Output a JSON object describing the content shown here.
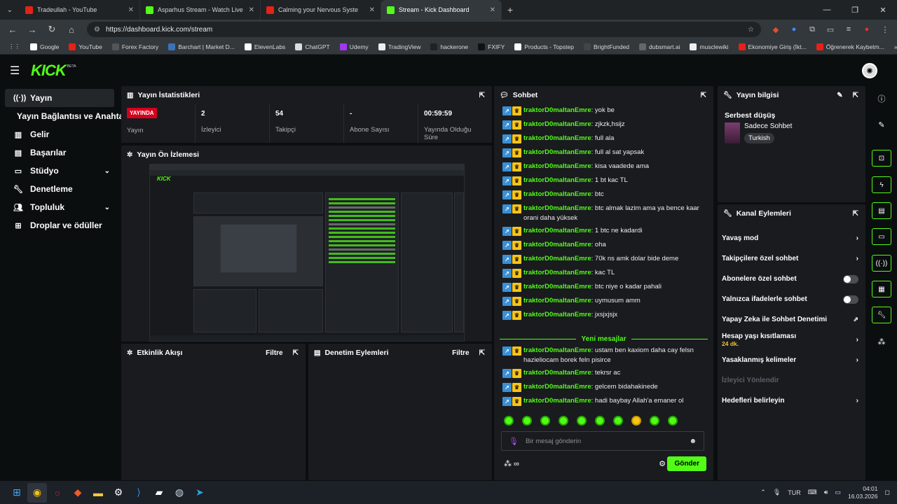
{
  "browser": {
    "tabs": [
      {
        "title": "Tradeullah - YouTube",
        "fav": "yt"
      },
      {
        "title": "Asparhus Stream - Watch Live o",
        "fav": "kick"
      },
      {
        "title": "Calming your Nervous Syste",
        "fav": "yt"
      },
      {
        "title": "Stream - Kick Dashboard",
        "fav": "kick"
      }
    ],
    "url": "https://dashboard.kick.com/stream",
    "bookmarks": [
      "Google",
      "YouTube",
      "Forex Factory",
      "Barchart | Market D...",
      "ElevenLabs",
      "ChatGPT",
      "Udemy",
      "TradingView",
      "hackerone",
      "FXIFY",
      "Products - Topstep",
      "BrightFunded",
      "dubsmart.ai",
      "musclewiki",
      "Ekonomiye Giriş (İkt...",
      "Öğrenerek Kaybetm..."
    ]
  },
  "app": {
    "logo": "KICK",
    "beta": "BETA",
    "sidebar": {
      "yayin": "Yayın",
      "baglanti": "Yayın Bağlantısı ve Anahtarı",
      "gelir": "Gelir",
      "basarilar": "Başarılar",
      "studyo": "Stüdyo",
      "denetleme": "Denetleme",
      "topluluk": "Topluluk",
      "droplar": "Droplar ve ödüller"
    },
    "stats": {
      "title": "Yayın İstatistikleri",
      "live_badge": "YAYINDA",
      "items": [
        {
          "value": "",
          "label": "Yayın"
        },
        {
          "value": "2",
          "label": "İzleyici"
        },
        {
          "value": "54",
          "label": "Takipçi"
        },
        {
          "value": "-",
          "label": "Abone Sayısı"
        },
        {
          "value": "00:59:59",
          "label": "Yayında Olduğu Süre"
        }
      ]
    },
    "preview_title": "Yayın Ön İzlemesi",
    "activity": {
      "title": "Etkinlik Akışı",
      "filter": "Filtre"
    },
    "moderation": {
      "title": "Denetim Eylemleri",
      "filter": "Filtre"
    },
    "chat": {
      "title": "Sohbet",
      "messages": [
        {
          "user": "traktorD0maltanEmre",
          "text": "yok be"
        },
        {
          "user": "traktorD0maltanEmre",
          "text": "zjkzk,hsijz"
        },
        {
          "user": "traktorD0maltanEmre",
          "text": "full ala"
        },
        {
          "user": "traktorD0maltanEmre",
          "text": "full al sat yapsak"
        },
        {
          "user": "traktorD0maltanEmre",
          "text": "kisa vaadede ama"
        },
        {
          "user": "traktorD0maltanEmre",
          "text": "1 bt kac TL"
        },
        {
          "user": "traktorD0maltanEmre",
          "text": "btc"
        },
        {
          "user": "traktorD0maltanEmre",
          "text": "btc almak lazim ama ya bence kaar orani daha yüksek"
        },
        {
          "user": "traktorD0maltanEmre",
          "text": "1 btc ne kadardi"
        },
        {
          "user": "traktorD0maltanEmre",
          "text": "oha"
        },
        {
          "user": "traktorD0maltanEmre",
          "text": "70k ns amk dolar bide deme"
        },
        {
          "user": "traktorD0maltanEmre",
          "text": "kac TL"
        },
        {
          "user": "traktorD0maltanEmre",
          "text": "btc niye o kadar pahali"
        },
        {
          "user": "traktorD0maltanEmre",
          "text": "uymusum amm"
        },
        {
          "user": "traktorD0maltanEmre",
          "text": "jxsjxjsjx"
        }
      ],
      "new_divider": "Yeni mesajlar",
      "new_messages": [
        {
          "user": "traktorD0maltanEmre",
          "text": "ustam ben kaxiom daha cay felsn hazieliocam borek feln pisirce"
        },
        {
          "user": "traktorD0maltanEmre",
          "text": "tekrsr ac"
        },
        {
          "user": "traktorD0maltanEmre",
          "text": "gelcem bidahakinede"
        },
        {
          "user": "traktorD0maltanEmre",
          "text": "hadi baybay Allah'a emaner ol"
        }
      ],
      "placeholder": "Bir mesaj gönderin",
      "send": "Gönder"
    },
    "info": {
      "title": "Yayın bilgisi",
      "stream_title": "Serbest düşüş",
      "category": "Sadece Sohbet",
      "language": "Turkish"
    },
    "channel_actions": {
      "title": "Kanal Eylemleri",
      "slow": "Yavaş mod",
      "followers": "Takipçilere özel sohbet",
      "subs": "Abonelere özel sohbet",
      "emotes": "Yalnızca ifadelerle sohbet",
      "ai": "Yapay Zeka ile Sohbet Denetimi",
      "age": "Hesap yaşı kısıtlaması",
      "age_sub": "24 dk.",
      "banned": "Yasaklanmış kelimeler",
      "viewer": "İzleyici Yönlendir",
      "goals": "Hedefleri belirleyin"
    }
  },
  "taskbar": {
    "lang": "TUR",
    "time": "04:01",
    "date": "16.03.2026"
  }
}
